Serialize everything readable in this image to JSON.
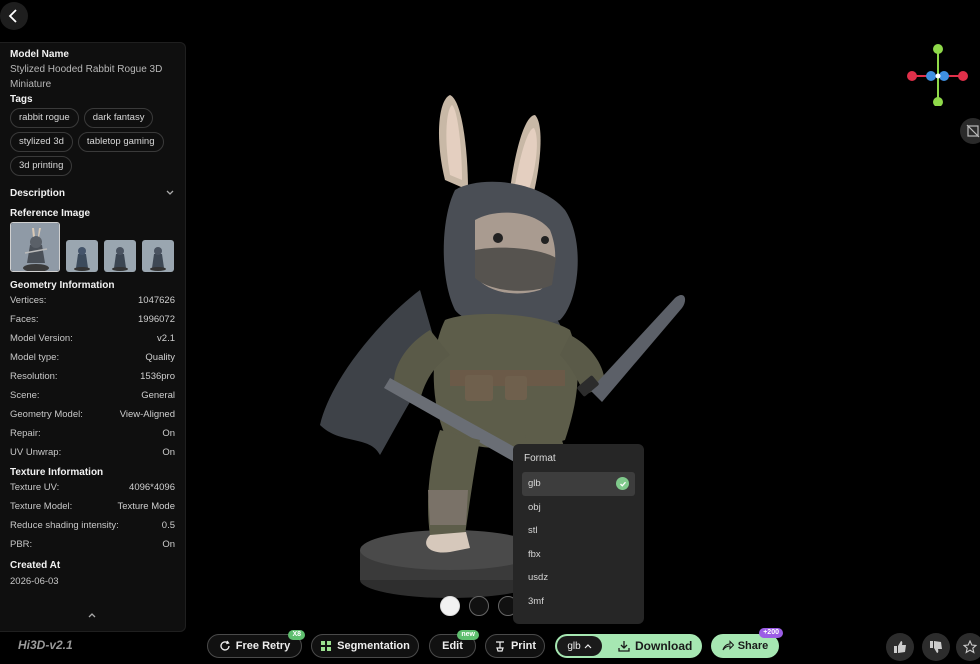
{
  "panel": {
    "model_name_title": "Model Name",
    "model_name_line1": "Stylized Hooded Rabbit Rogue 3D",
    "model_name_line2": "Miniature",
    "tags_title": "Tags",
    "tags": [
      "rabbit rogue",
      "dark fantasy",
      "stylized 3d",
      "tabletop gaming",
      "3d printing"
    ],
    "description_title": "Description",
    "reference_title": "Reference Image",
    "geometry_title": "Geometry Information",
    "geometry": [
      {
        "k": "Vertices:",
        "v": "1047626"
      },
      {
        "k": "Faces:",
        "v": "1996072"
      },
      {
        "k": "Model Version:",
        "v": "v2.1"
      },
      {
        "k": "Model type:",
        "v": "Quality"
      },
      {
        "k": "Resolution:",
        "v": "1536pro"
      },
      {
        "k": "Scene:",
        "v": "General"
      },
      {
        "k": "Geometry Model:",
        "v": "View-Aligned"
      },
      {
        "k": "Repair:",
        "v": "On"
      },
      {
        "k": "UV Unwrap:",
        "v": "On"
      }
    ],
    "texture_title": "Texture Information",
    "texture": [
      {
        "k": "Texture UV:",
        "v": "4096*4096"
      },
      {
        "k": "Texture Model:",
        "v": "Texture Mode"
      },
      {
        "k": "Reduce shading intensity:",
        "v": "0.5"
      },
      {
        "k": "PBR:",
        "v": "On"
      }
    ],
    "created_title": "Created At",
    "created_value": "2026-06-03"
  },
  "version_label": "Hi3D-v2.1",
  "format_menu": {
    "title": "Format",
    "options": [
      "glb",
      "obj",
      "stl",
      "fbx",
      "usdz",
      "3mf"
    ],
    "selected": "glb"
  },
  "toolbar": {
    "free_retry": "Free Retry",
    "free_retry_badge": "X8",
    "segmentation": "Segmentation",
    "edit": "Edit",
    "edit_badge": "new",
    "print": "Print",
    "format_value": "glb",
    "download": "Download",
    "share": "Share",
    "share_badge": "+200"
  },
  "colors": {
    "accent_green": "#a6e7b2",
    "check_green": "#7fc98b",
    "axis_red": "#e0304a",
    "axis_green": "#8fd94a",
    "axis_blue": "#3f8fe0"
  }
}
